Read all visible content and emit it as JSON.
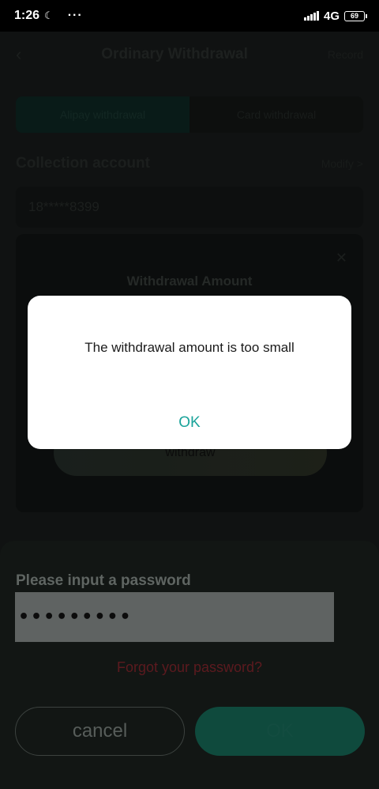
{
  "status_bar": {
    "time": "1:26",
    "moon_icon": "moon-icon",
    "dots": "···",
    "network": "4G",
    "battery": "69"
  },
  "page": {
    "title": "Ordinary Withdrawal",
    "back_icon": "back-arrow-icon",
    "header_right": "Record",
    "tabs": [
      {
        "label": "Alipay withdrawal"
      },
      {
        "label": "Card withdrawal"
      }
    ],
    "collection_label": "Collection account",
    "collection_more": "Modify >",
    "account_value": "18*****8399"
  },
  "withdraw_sheet": {
    "title": "Withdrawal Amount",
    "close_icon": "close-icon",
    "withdraw_button": "withdraw"
  },
  "password_sheet": {
    "label": "Please input a password",
    "password_value": "•••••••••",
    "forgot_link": "Forgot your password?",
    "cancel_button": "cancel",
    "ok_button": "OK"
  },
  "alert": {
    "message": "The withdrawal amount is too small",
    "ok_label": "OK"
  },
  "colors": {
    "accent": "#1aa39a",
    "forgot_link": "#5c1a1f",
    "ok_button_bg": "#0f4a3d"
  }
}
